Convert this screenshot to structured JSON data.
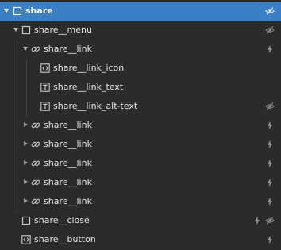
{
  "tree": {
    "rows": [
      {
        "label": "share",
        "icon": "square-icon",
        "expanded": true,
        "selected": true,
        "actions": [
          "eye-slash-icon"
        ]
      },
      {
        "label": "share__menu",
        "icon": "square-icon",
        "expanded": true,
        "actions": [
          "eye-slash-icon"
        ]
      },
      {
        "label": "share__link",
        "icon": "link-icon",
        "expanded": true,
        "actions": [
          "lightning-icon"
        ]
      },
      {
        "label": "share__link_icon",
        "icon": "embed-icon",
        "actions": []
      },
      {
        "label": "share__link_text",
        "icon": "text-icon",
        "actions": []
      },
      {
        "label": "share__link_alt-text",
        "icon": "text-icon",
        "actions": [
          "eye-slash-icon"
        ]
      },
      {
        "label": "share__link",
        "icon": "link-icon",
        "expanded": false,
        "actions": [
          "lightning-icon"
        ]
      },
      {
        "label": "share__link",
        "icon": "link-icon",
        "expanded": false,
        "actions": [
          "lightning-icon"
        ]
      },
      {
        "label": "share__link",
        "icon": "link-icon",
        "expanded": false,
        "actions": [
          "lightning-icon"
        ]
      },
      {
        "label": "share__link",
        "icon": "link-icon",
        "expanded": false,
        "actions": [
          "lightning-icon"
        ]
      },
      {
        "label": "share__link",
        "icon": "link-icon",
        "expanded": false,
        "actions": [
          "lightning-icon"
        ]
      },
      {
        "label": "share__close",
        "icon": "square-icon",
        "actions": [
          "lightning-icon",
          "eye-slash-icon"
        ]
      },
      {
        "label": "share__button",
        "icon": "embed-icon",
        "actions": [
          "lightning-icon"
        ]
      }
    ]
  },
  "colors": {
    "background": "#2b2b2b",
    "selected": "#3b7fc4",
    "text": "#e6e6e6",
    "icon": "#c8c8c8",
    "muted_icon": "#8a8a8a"
  }
}
